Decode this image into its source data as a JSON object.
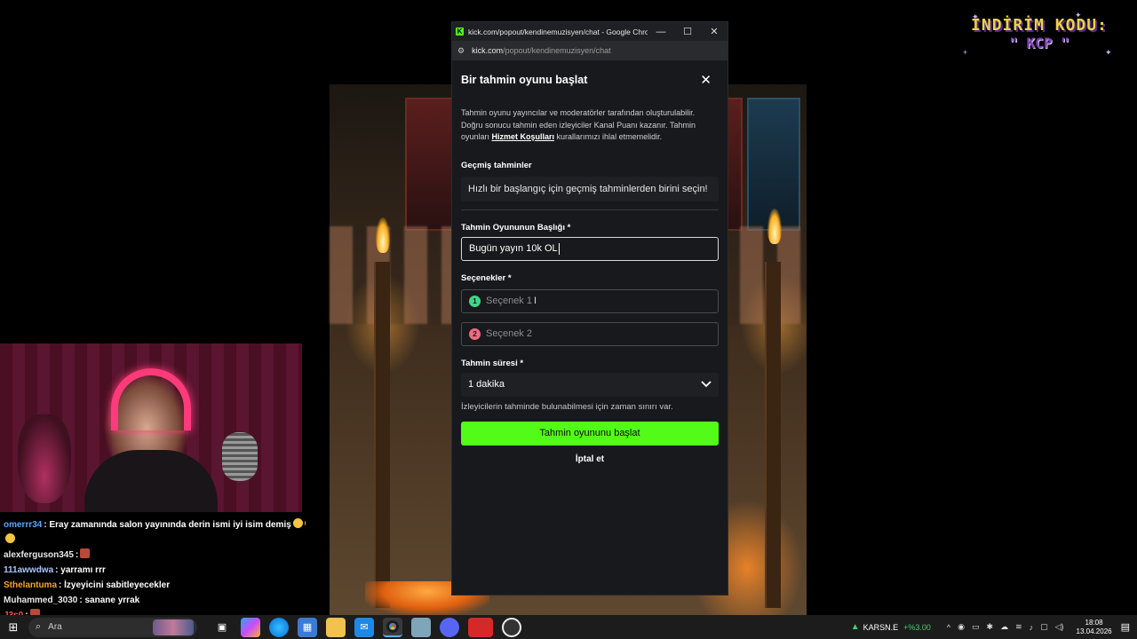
{
  "browser": {
    "title": "kick.com/popout/kendinemuzisyen/chat - Google Chro...",
    "url_host": "kick.com",
    "url_path": "/popout/kendinemuzisyen/chat",
    "controls": {
      "minimize": "—",
      "maximize": "☐",
      "close": "✕"
    }
  },
  "modal": {
    "title": "Bir tahmin oyunu başlat",
    "close": "✕",
    "description_pre": "Tahmin oyunu yayıncılar ve moderatörler tarafından oluşturulabilir. Doğru sonucu tahmin eden izleyiciler Kanal Puanı kazanır. Tahmin oyunları ",
    "terms_link": "Hizmet Koşulları",
    "description_post": " kurallarımızı ihlal etmemelidir.",
    "past_label": "Geçmiş tahminler",
    "past_placeholder": "Hızlı bir başlangıç için geçmiş tahminlerden birini seçin!",
    "title_label": "Tahmin Oyununun Başlığı *",
    "title_value": "Bugün yayın 10k OL",
    "options_label": "Seçenekler *",
    "options": [
      {
        "number": "1",
        "placeholder": "Seçenek 1",
        "color": "#3fd68a"
      },
      {
        "number": "2",
        "placeholder": "Seçenek 2",
        "color": "#f06a82"
      }
    ],
    "duration_label": "Tahmin süresi *",
    "duration_value": "1 dakika",
    "duration_hint": "İzleyicilerin tahminde bulunabilmesi için zaman sınırı var.",
    "submit": "Tahmin oyununu başlat",
    "cancel": "İptal et"
  },
  "overlay_chat": [
    {
      "user": "omerrr34",
      "color": "#5aa8ff",
      "text": ": Eray zamanında salon yayınında derin ismi iyi isim demiş"
    },
    {
      "user": "alexferguson345",
      "color": "#e8e8e8",
      "text": ":"
    },
    {
      "user": "111awwdwa",
      "color": "#a8c8ff",
      "text": ": yarramı rrr"
    },
    {
      "user": "Sthelantuma",
      "color": "#f5a623",
      "text": ": İzyeyicini sabitleyecekler"
    },
    {
      "user": "Muhammed_3030",
      "color": "#e8e8e8",
      "text": ": sanane yrrak"
    },
    {
      "user": "J3s0",
      "color": "#ff4d4d",
      "text": ":"
    }
  ],
  "promo": {
    "line1": "İNDİRİM KODU:",
    "line2": "\" KCP \""
  },
  "taskbar": {
    "start": "⊞",
    "search_placeholder": "Ara",
    "stock_name": "KARSN.E",
    "stock_change": "+%3.00",
    "time": "18:08",
    "date": "13.04.2026"
  },
  "colors": {
    "accent": "#53fc18",
    "panel": "#18191c"
  }
}
